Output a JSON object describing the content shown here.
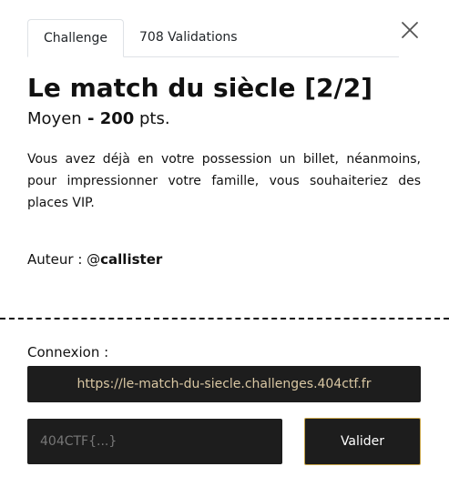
{
  "tabs": [
    {
      "label": "Challenge",
      "active": true
    },
    {
      "label": "708 Validations",
      "active": false
    }
  ],
  "challenge": {
    "title": "Le match du siècle [2/2]",
    "difficulty": "Moyen",
    "separator": " - ",
    "points": "200",
    "points_unit": " pts.",
    "description": "Vous avez déjà en votre possession un billet, néanmoins, pour impressionner votre famille, vous souhaiteriez des places VIP.",
    "author_label": "Auteur : @",
    "author_name": "callister"
  },
  "connection": {
    "label": "Connexion :",
    "url": "https://le-match-du-siecle.challenges.404ctf.fr"
  },
  "form": {
    "flag_placeholder": "404CTF{...}",
    "flag_value": "",
    "submit_label": "Valider"
  },
  "icons": {
    "close": "close-icon"
  },
  "colors": {
    "dark_field": "#1d1d1d",
    "url_text": "#d9c7a3",
    "button_border": "#c9a64a"
  }
}
